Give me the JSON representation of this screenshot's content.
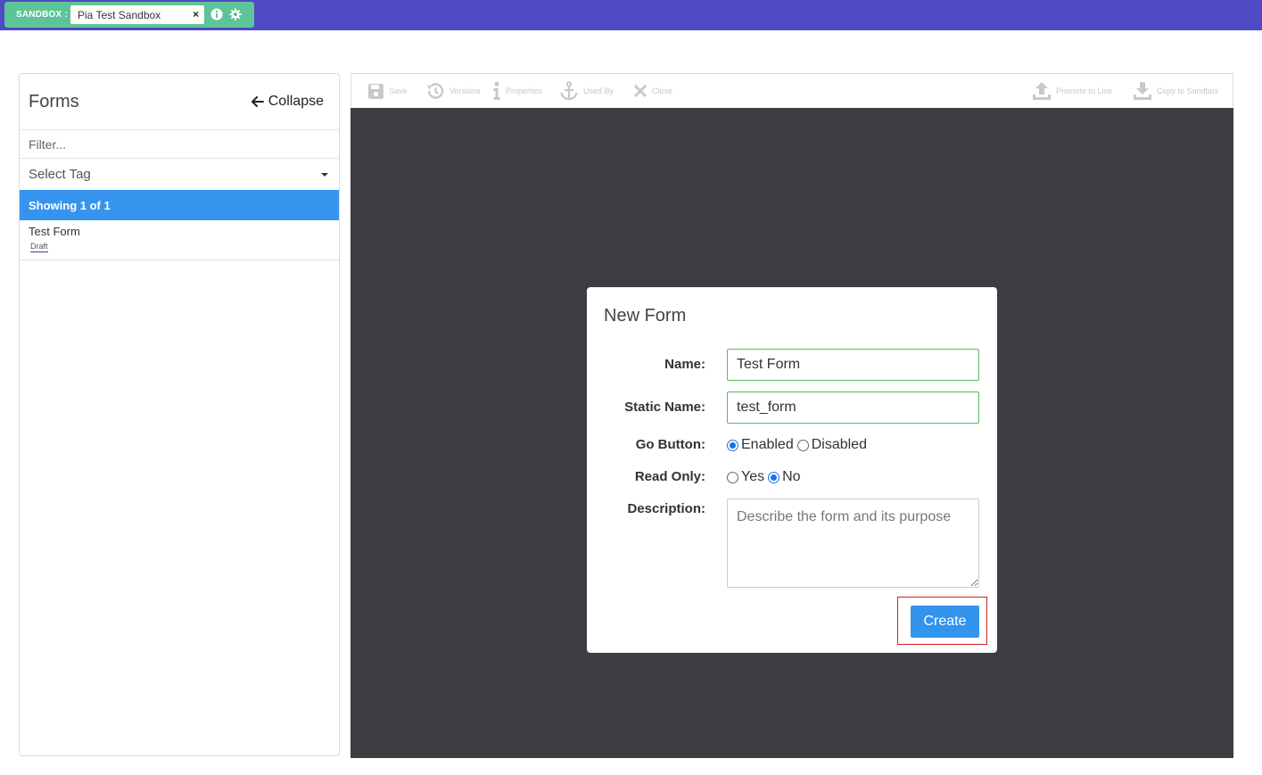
{
  "topbar": {
    "sandbox_label": "SANDBOX :",
    "sandbox_selected": "Pia Test Sandbox",
    "clear_glyph": "×",
    "icons": [
      "info-icon",
      "gear-icon"
    ]
  },
  "sidebar": {
    "title": "Forms",
    "collapse_label": "Collapse",
    "filter_placeholder": "Filter...",
    "tag_select_label": "Select Tag",
    "showing_text": "Showing 1 of 1",
    "items": [
      {
        "name": "Test Form",
        "status": "Draft"
      }
    ]
  },
  "toolbar": {
    "save": "Save",
    "versions": "Versions",
    "properties": "Properties",
    "used_by": "Used By",
    "close": "Close",
    "promote": "Promote to Live",
    "copy": "Copy to Sandbox"
  },
  "modal": {
    "title": "New Form",
    "name_label": "Name:",
    "name_value": "Test Form",
    "static_name_label": "Static Name:",
    "static_name_value": "test_form",
    "go_button_label": "Go Button:",
    "go_options": [
      "Enabled",
      "Disabled"
    ],
    "go_selected": "Enabled",
    "read_only_label": "Read Only:",
    "read_only_options": [
      "Yes",
      "No"
    ],
    "read_only_selected": "No",
    "description_label": "Description:",
    "description_placeholder": "Describe the form and its purpose",
    "create_label": "Create"
  },
  "colors": {
    "topbar": "#4d4ac4",
    "sandbox_pill": "#5cc497",
    "accent_blue": "#3794ee",
    "canvas": "#3c3d41",
    "valid_border": "#5cb85c",
    "highlight_red": "#cc2222"
  }
}
